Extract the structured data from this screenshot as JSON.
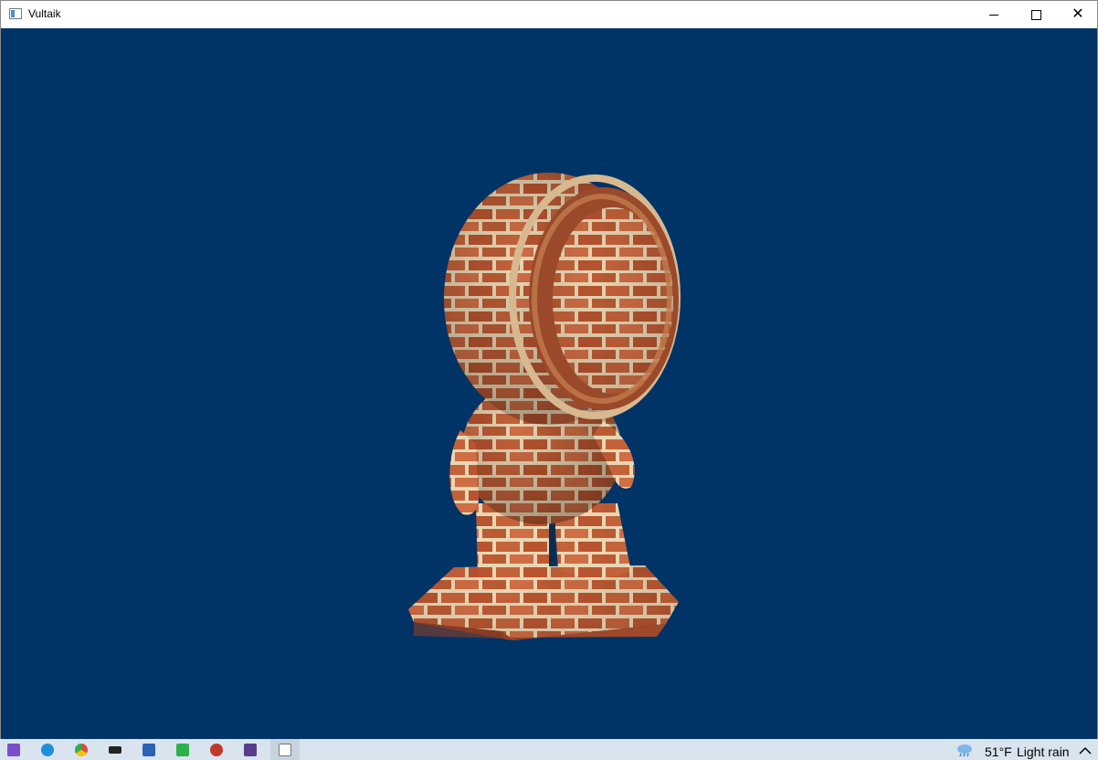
{
  "window": {
    "title": "Vultaik",
    "icon": "app-window-icon",
    "controls": {
      "minimize": "minimize-icon",
      "maximize": "maximize-icon",
      "close": "close-icon"
    }
  },
  "viewport": {
    "background_color": "#003366",
    "subject": "brick-textured-material-test-figure"
  },
  "taskbar": {
    "apps": [
      {
        "name": "visual-studio-icon",
        "color": "#7b4fc9"
      },
      {
        "name": "edge-icon",
        "color": "#1f8fd9"
      },
      {
        "name": "chrome-icon",
        "color": "#e04a3a"
      },
      {
        "name": "terminal-icon",
        "color": "#222222"
      },
      {
        "name": "app-blue-icon",
        "color": "#2a62b5"
      },
      {
        "name": "app-green-icon",
        "color": "#2bb24c"
      },
      {
        "name": "app-bug-icon",
        "color": "#c0392b"
      },
      {
        "name": "app-cn-icon",
        "color": "#5a3d8a"
      },
      {
        "name": "vultaik-taskbar-icon",
        "color": "#4a8fc7"
      }
    ],
    "tray": {
      "temperature": "51°F",
      "weather": "Light rain",
      "weather_icon": "rain-cloud-icon",
      "overflow_icon": "chevron-up-icon"
    }
  }
}
